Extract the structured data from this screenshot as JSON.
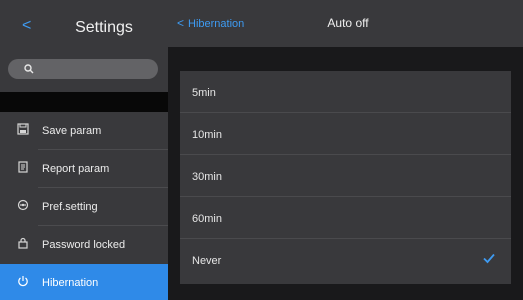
{
  "sidebar": {
    "back_glyph": "<",
    "title": "Settings",
    "search_icon": "search-icon",
    "items": [
      {
        "label": "Save param",
        "icon": "save-icon"
      },
      {
        "label": "Report param",
        "icon": "report-icon"
      },
      {
        "label": "Pref.setting",
        "icon": "preference-icon"
      },
      {
        "label": "Password locked",
        "icon": "lock-icon"
      },
      {
        "label": "Hibernation",
        "icon": "power-icon",
        "selected": true
      }
    ]
  },
  "main": {
    "back_label": "Hibernation",
    "back_glyph": "<",
    "title": "Auto off",
    "options": [
      {
        "label": "5min"
      },
      {
        "label": "10min"
      },
      {
        "label": "30min"
      },
      {
        "label": "60min"
      },
      {
        "label": "Never",
        "selected": true
      }
    ]
  },
  "colors": {
    "accent": "#2f8ae8",
    "panel": "#39393c",
    "background": "#19191b"
  }
}
